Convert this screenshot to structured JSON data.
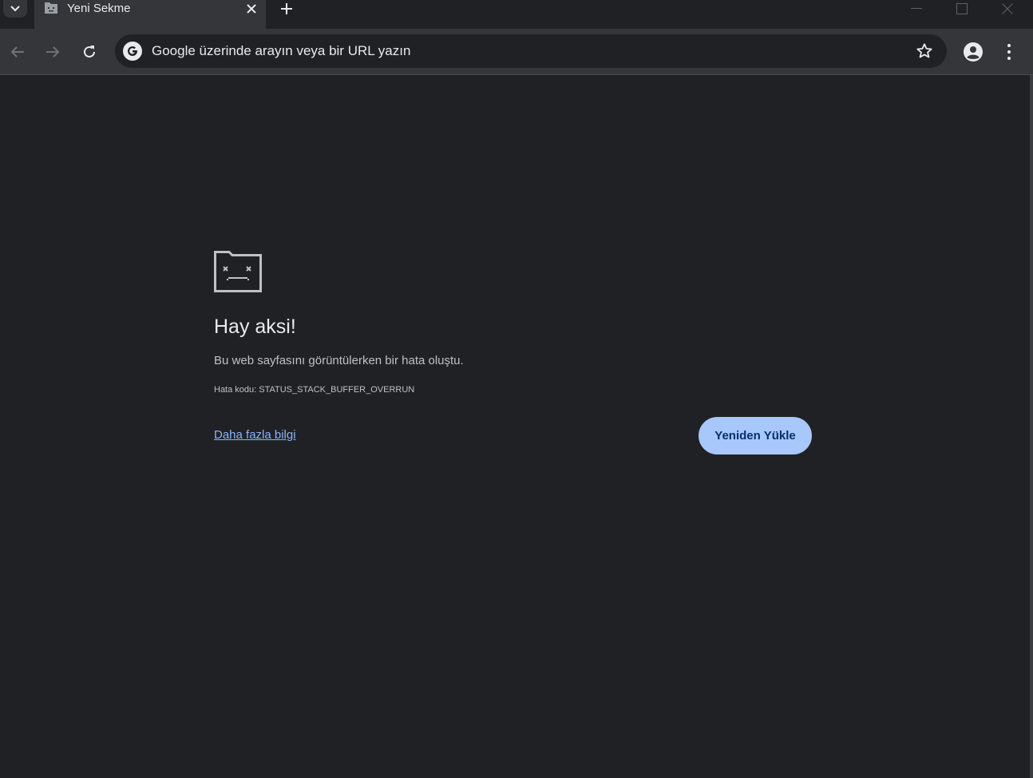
{
  "tabstrip": {
    "tab_title": "Yeni Sekme",
    "icons": {
      "tab_search": "chevron-down-icon",
      "favicon": "sad-tab-favicon-icon",
      "tab_close": "close-icon",
      "new_tab": "plus-icon",
      "minimize": "minimize-icon",
      "maximize": "maximize-icon",
      "window_close": "close-icon"
    }
  },
  "toolbar": {
    "omnibox_placeholder": "Google üzerinde arayın veya bir URL yazın",
    "icons": {
      "back": "arrow-left-icon",
      "forward": "arrow-right-icon",
      "reload": "reload-icon",
      "search_engine": "google-g-icon",
      "bookmark": "star-icon",
      "profile": "profile-icon",
      "menu": "kebab-menu-icon"
    }
  },
  "error_page": {
    "heading": "Hay aksi!",
    "message": "Bu web sayfasını görüntülerken bir hata oluştu.",
    "error_code": "Hata kodu: STATUS_STACK_BUFFER_OVERRUN",
    "learn_more_link": "Daha fazla bilgi",
    "reload_button": "Yeniden Yükle"
  },
  "colors": {
    "background": "#202124",
    "toolbar": "#35363a",
    "text_primary": "#e8eaed",
    "text_secondary": "#bdc1c6",
    "link": "#8ab4f8",
    "button_bg": "#a8c7fa",
    "button_text": "#062e6f"
  }
}
